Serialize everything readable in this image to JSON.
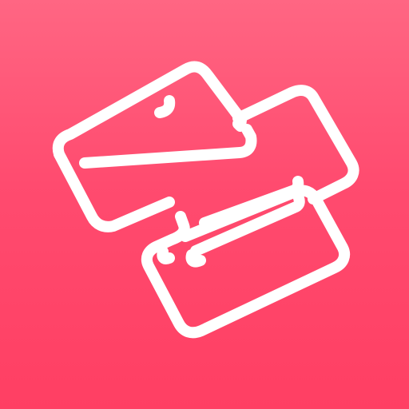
{
  "app_icon": {
    "name": "stacked-cards-logo",
    "icon": "stacked-cards-icon",
    "colors": {
      "background_top": "#FF6683",
      "background_bottom": "#FF3F63",
      "glyph": "#FFFFFF"
    }
  }
}
